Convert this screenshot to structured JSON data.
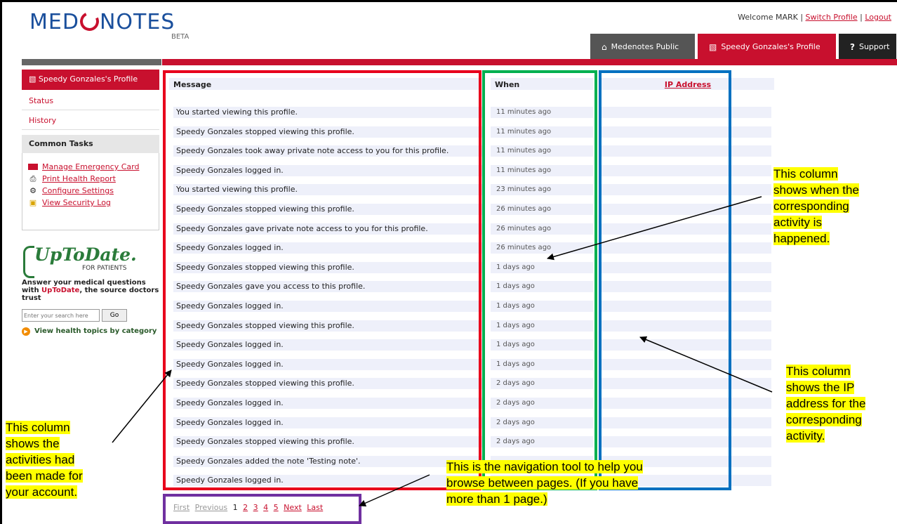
{
  "header": {
    "logo_text_left": "MED",
    "logo_text_right": "NOTES",
    "logo_beta": "BETA",
    "welcome_prefix": "Welcome MARK |",
    "switch_profile": "Switch Profile",
    "separator": "|",
    "logout": "Logout",
    "tabs": [
      {
        "label": "Medenotes Public",
        "icon": "home-icon"
      },
      {
        "label": "Speedy Gonzales's Profile",
        "icon": "chart-icon"
      },
      {
        "label": "Support",
        "icon": "question-icon"
      }
    ]
  },
  "sidebar": {
    "profile_label": "Speedy Gonzales's Profile",
    "items": [
      {
        "label": "Status"
      },
      {
        "label": "History"
      }
    ],
    "common_tasks_title": "Common Tasks",
    "tasks": [
      {
        "label": "Manage Emergency Card",
        "icon": "card-icon"
      },
      {
        "label": "Print Health Report",
        "icon": "printer-icon"
      },
      {
        "label": "Configure Settings",
        "icon": "gear-icon"
      },
      {
        "label": "View Security Log",
        "icon": "log-icon"
      }
    ],
    "uptodate": {
      "logo": "UpToDate.",
      "subtitle": "FOR PATIENTS",
      "text_before": "Answer your medical questions with ",
      "text_link": "UpToDate",
      "text_after": ", the source doctors trust",
      "search_placeholder": "Enter your search here",
      "go_label": "Go",
      "topics_label": "View health topics by category"
    }
  },
  "log_table": {
    "headers": {
      "message": "Message",
      "when": "When",
      "ip": "IP Address"
    },
    "rows": [
      {
        "message": "You started viewing this profile.",
        "when": "11 minutes ago"
      },
      {
        "message": "Speedy Gonzales stopped viewing this profile.",
        "when": "11 minutes ago"
      },
      {
        "message": "Speedy Gonzales took away private note access to you for this profile.",
        "when": "11 minutes ago"
      },
      {
        "message": "Speedy Gonzales logged in.",
        "when": "11 minutes ago"
      },
      {
        "message": "You started viewing this profile.",
        "when": "23 minutes ago"
      },
      {
        "message": "Speedy Gonzales stopped viewing this profile.",
        "when": "26 minutes ago"
      },
      {
        "message": "Speedy Gonzales gave private note access to you for this profile.",
        "when": "26 minutes ago"
      },
      {
        "message": "Speedy Gonzales logged in.",
        "when": "26 minutes ago"
      },
      {
        "message": "Speedy Gonzales stopped viewing this profile.",
        "when": "1 days ago"
      },
      {
        "message": "Speedy Gonzales gave you access to this profile.",
        "when": "1 days ago"
      },
      {
        "message": "Speedy Gonzales logged in.",
        "when": "1 days ago"
      },
      {
        "message": "Speedy Gonzales stopped viewing this profile.",
        "when": "1 days ago"
      },
      {
        "message": "Speedy Gonzales logged in.",
        "when": "1 days ago"
      },
      {
        "message": "Speedy Gonzales logged in.",
        "when": "1 days ago"
      },
      {
        "message": "Speedy Gonzales stopped viewing this profile.",
        "when": "2 days ago"
      },
      {
        "message": "Speedy Gonzales logged in.",
        "when": "2 days ago"
      },
      {
        "message": "Speedy Gonzales logged in.",
        "when": "2 days ago"
      },
      {
        "message": "Speedy Gonzales stopped viewing this profile.",
        "when": "2 days ago"
      },
      {
        "message": "Speedy Gonzales added the note 'Testing note'.",
        "when": ""
      },
      {
        "message": "Speedy Gonzales logged in.",
        "when": ""
      }
    ]
  },
  "pager": {
    "first": "First",
    "previous": "Previous",
    "current": "1",
    "pages": [
      "2",
      "3",
      "4",
      "5"
    ],
    "next": "Next",
    "last": "Last"
  },
  "annotations": {
    "when_column": [
      "This column",
      "shows when the",
      "corresponding",
      "activity is",
      "happened."
    ],
    "ip_column": [
      "This column",
      "shows the IP",
      "address for the",
      "corresponding",
      "activity."
    ],
    "message_column": [
      "This column",
      "shows the",
      "activities had",
      "been made for",
      "your account."
    ],
    "navigation": [
      "This is the navigation tool to help you",
      "browse between pages. (If you have",
      "more than 1 page.)"
    ]
  },
  "colors": {
    "brand_red": "#c8102e",
    "brand_blue": "#1a4f9c",
    "highlight_yellow": "#ffff00",
    "box_red": "#e8001c",
    "box_green": "#00b050",
    "box_blue": "#0070c0",
    "box_purple": "#7030a0"
  }
}
